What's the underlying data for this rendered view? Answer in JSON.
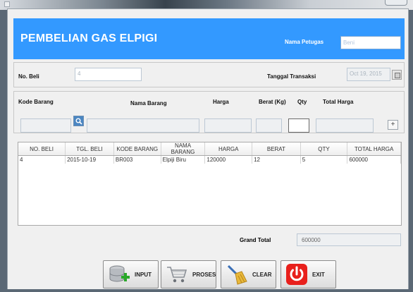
{
  "header": {
    "title": "PEMBELIAN GAS ELPIGI",
    "officer_label": "Nama Petugas",
    "officer_value": "Beni"
  },
  "purchase": {
    "no_beli_label": "No. Beli",
    "no_beli_value": "4",
    "date_label": "Tanggal Transaksi",
    "date_value": "Oct 19, 2015"
  },
  "item": {
    "kode_label": "Kode Barang",
    "nama_label": "Nama Barang",
    "harga_label": "Harga",
    "berat_label": "Berat (Kg)",
    "qty_label": "Qty",
    "total_label": "Total Harga",
    "add_glyph": "+"
  },
  "table": {
    "headers": [
      "NO. BELI",
      "TGL. BELI",
      "KODE BARANG",
      "NAMA BARANG",
      "HARGA",
      "BERAT",
      "QTY",
      "TOTAL HARGA"
    ],
    "rows": [
      [
        "4",
        "2015-10-19",
        "BR003",
        "Elpiji Biru",
        "120000",
        "12",
        "5",
        "600000"
      ]
    ]
  },
  "grand_total": {
    "label": "Grand Total",
    "value": "600000"
  },
  "buttons": {
    "input": "INPUT",
    "proses": "PROSES",
    "clear": "CLEAR",
    "exit": "EXIT"
  },
  "colors": {
    "header_bg": "#3399ff",
    "exit_red": "#e8201c",
    "window_bg": "#f0f0f0"
  },
  "icons": [
    "search-icon",
    "calendar-icon",
    "plus-icon",
    "database-add-icon",
    "cart-icon",
    "broom-icon",
    "power-icon"
  ]
}
